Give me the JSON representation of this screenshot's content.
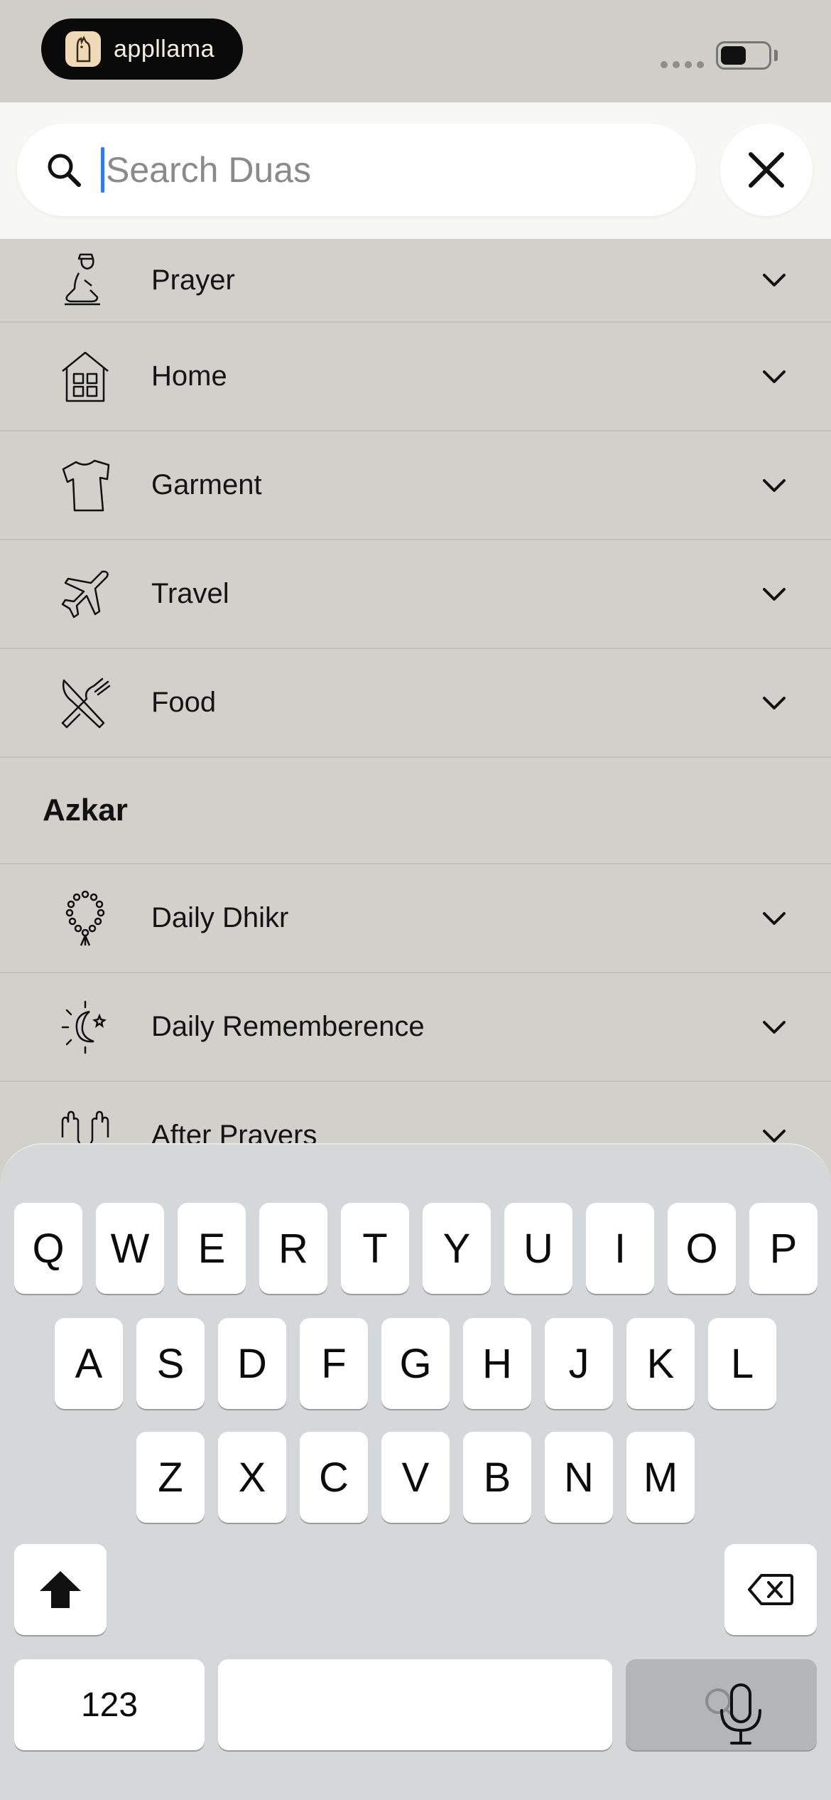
{
  "status_bar": {
    "brand_name": "appllama",
    "battery_level": 0.55
  },
  "search": {
    "placeholder": "Search Duas",
    "value": "",
    "search_icon": "search-icon",
    "clear_icon": "close-icon"
  },
  "list": {
    "rows": [
      {
        "label": "Prayer",
        "icon": "praying-person-icon"
      },
      {
        "label": "Home",
        "icon": "house-icon"
      },
      {
        "label": "Garment",
        "icon": "tshirt-icon"
      },
      {
        "label": "Travel",
        "icon": "airplane-icon"
      },
      {
        "label": "Food",
        "icon": "fork-knife-icon"
      }
    ],
    "section": "Azkar",
    "azkar_rows": [
      {
        "label": "Daily Dhikr",
        "icon": "prayer-beads-icon"
      },
      {
        "label": "Daily Rememberence",
        "icon": "moon-sun-icon"
      },
      {
        "label": "After Prayers",
        "icon": "praying-hands-icon"
      }
    ]
  },
  "keyboard": {
    "row1": [
      "Q",
      "W",
      "E",
      "R",
      "T",
      "Y",
      "U",
      "I",
      "O",
      "P"
    ],
    "row2": [
      "A",
      "S",
      "D",
      "F",
      "G",
      "H",
      "J",
      "K",
      "L"
    ],
    "row3": [
      "Z",
      "X",
      "C",
      "V",
      "B",
      "N",
      "M"
    ],
    "numbers_key": "123",
    "shift_icon": "shift-icon",
    "delete_icon": "backspace-icon",
    "search_key_icon": "search-icon",
    "mic_icon": "microphone-icon"
  }
}
